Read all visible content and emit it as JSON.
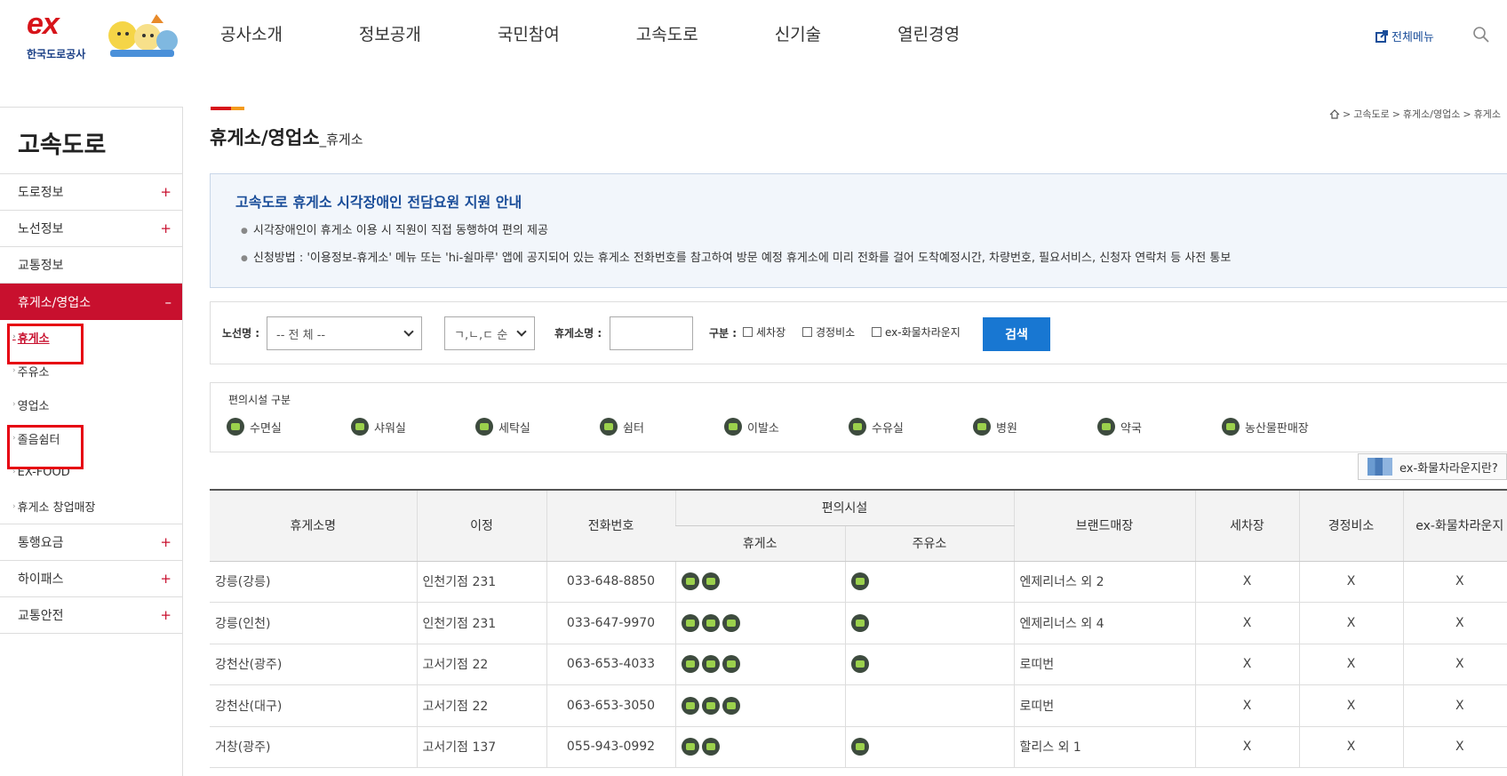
{
  "header": {
    "logo_text": "ex",
    "logo_corp": "한국도로공사",
    "gnb": [
      "공사소개",
      "정보공개",
      "국민참여",
      "고속도로",
      "신기술",
      "열린경영"
    ],
    "all_menu_label": "전체메뉴"
  },
  "lnb": {
    "title": "고속도로",
    "items_top": [
      {
        "label": "도로정보",
        "icon": "+"
      },
      {
        "label": "노선정보",
        "icon": "+"
      },
      {
        "label": "교통정보",
        "icon": ""
      }
    ],
    "active": {
      "label": "휴게소/영업소",
      "icon": "–"
    },
    "subs": [
      "휴게소",
      "주유소",
      "영업소",
      "졸음쉼터",
      "EX-FOOD",
      "휴게소 창업매장"
    ],
    "sub_caret": "›",
    "items_bottom": [
      {
        "label": "통행요금",
        "icon": "+"
      },
      {
        "label": "하이패스",
        "icon": "+"
      },
      {
        "label": "교통안전",
        "icon": "+"
      }
    ]
  },
  "breadcrumb": {
    "sep": ">",
    "items": [
      "고속도로",
      "휴게소/영업소",
      "휴게소"
    ]
  },
  "page_title": {
    "main": "휴게소/영업소",
    "sub": "_휴게소"
  },
  "notice": {
    "title": "고속도로 휴게소 시각장애인 전담요원 지원 안내",
    "line1": "시각장애인이 휴게소 이용 시 직원이 직접 동행하여 편의 제공",
    "line2": "신청방법 : '이용정보-휴게소' 메뉴 또는 'hi-쉴마루' 앱에 공지되어 있는 휴게소 전화번호를 참고하여 방문 예정 휴게소에 미리 전화를 걸어 도착예정시간, 차량번호, 필요서비스, 신청자 연락처 등 사전 통보"
  },
  "filter": {
    "route_label": "노선명 :",
    "route_value": "-- 전 체 --",
    "order_value": "ㄱ,ㄴ,ㄷ 순",
    "name_label": "휴게소명 :",
    "name_value": "",
    "type_label": "구분 :",
    "checks": [
      "세차장",
      "경정비소",
      "ex-화물차라운지"
    ],
    "search_button": "검색"
  },
  "facilities": {
    "title": "편의시설 구분",
    "items": [
      "수면실",
      "샤워실",
      "세탁실",
      "쉼터",
      "이발소",
      "수유실",
      "병원",
      "약국",
      "농산물판매장"
    ]
  },
  "cargo_button": "ex-화물차라운지란?",
  "table": {
    "headers": {
      "name": "휴게소명",
      "distance": "이정",
      "phone": "전화번호",
      "facility": "편의시설",
      "facility_rest": "휴게소",
      "facility_gas": "주유소",
      "brand": "브랜드매장",
      "wash": "세차장",
      "repair": "경정비소",
      "cargo": "ex-화물차라운지"
    },
    "rows": [
      {
        "name": "강릉(강릉)",
        "distance": "인천기점 231",
        "phone": "033-648-8850",
        "rest_icons": [
          "수유실",
          "쉼터"
        ],
        "gas_icons": [
          "쉼터"
        ],
        "brand": "엔제리너스 외 2",
        "wash": "X",
        "repair": "X",
        "cargo": "X"
      },
      {
        "name": "강릉(인천)",
        "distance": "인천기점 231",
        "phone": "033-647-9970",
        "rest_icons": [
          "수유실",
          "농산물판매장",
          "쉼터"
        ],
        "gas_icons": [
          "쉼터"
        ],
        "brand": "엔제리너스 외 4",
        "wash": "X",
        "repair": "X",
        "cargo": "X"
      },
      {
        "name": "강천산(광주)",
        "distance": "고서기점 22",
        "phone": "063-653-4033",
        "rest_icons": [
          "수유실",
          "농산물판매장",
          "쉼터"
        ],
        "gas_icons": [
          "쉼터"
        ],
        "brand": "로띠번",
        "wash": "X",
        "repair": "X",
        "cargo": "X"
      },
      {
        "name": "강천산(대구)",
        "distance": "고서기점 22",
        "phone": "063-653-3050",
        "rest_icons": [
          "수유실",
          "농산물판매장",
          "쉼터"
        ],
        "gas_icons": [],
        "brand": "로띠번",
        "wash": "X",
        "repair": "X",
        "cargo": "X"
      },
      {
        "name": "거창(광주)",
        "distance": "고서기점 137",
        "phone": "055-943-0992",
        "rest_icons": [
          "수유실",
          "농산물판매장"
        ],
        "gas_icons": [
          "쉼터"
        ],
        "brand": "할리스 외 1",
        "wash": "X",
        "repair": "X",
        "cargo": "X"
      }
    ]
  },
  "colors": {
    "accent": "#c8102e",
    "blue": "#1877d2",
    "icon_bg": "#3d4b3e",
    "icon_fg": "#9bd14c"
  }
}
